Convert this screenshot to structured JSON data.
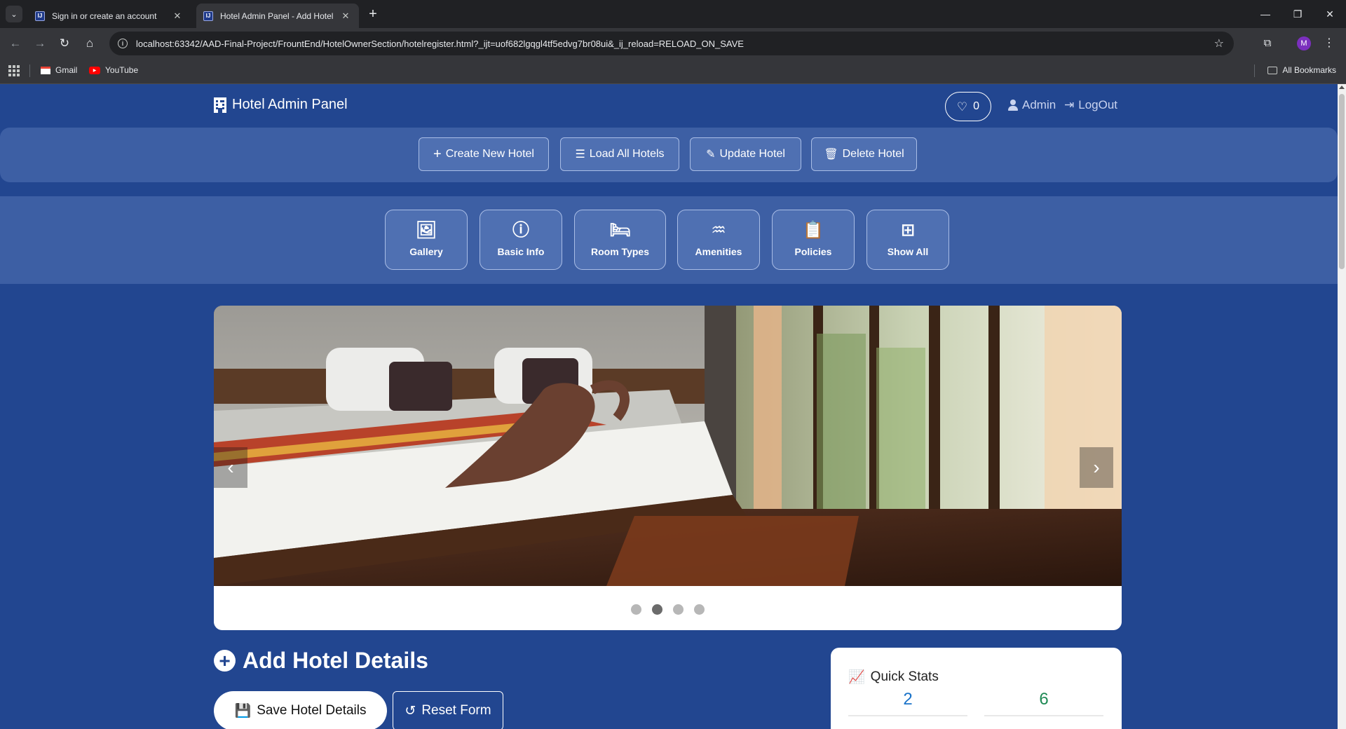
{
  "browser": {
    "tabs": [
      {
        "title": "Sign in or create an account",
        "favicon": "IJ"
      },
      {
        "title": "Hotel Admin Panel - Add Hotel",
        "favicon": "IJ"
      }
    ],
    "url": "localhost:63342/AAD-Final-Project/FrountEnd/HotelOwnerSection/hotelregister.html?_ijt=uof682lgqgl4tf5edvg7br08ui&_ij_reload=RELOAD_ON_SAVE",
    "profile_initial": "M",
    "bookmarks": [
      {
        "label": "Gmail"
      },
      {
        "label": "YouTube"
      }
    ],
    "all_bookmarks": "All Bookmarks"
  },
  "header": {
    "brand": "Hotel Admin Panel",
    "favorites_count": "0",
    "admin_label": "Admin",
    "logout_label": "LogOut"
  },
  "actions": [
    {
      "label": "Create New Hotel",
      "icon": "plus-icon"
    },
    {
      "label": "Load All Hotels",
      "icon": "list-icon"
    },
    {
      "label": "Update Hotel",
      "icon": "edit-icon"
    },
    {
      "label": "Delete Hotel",
      "icon": "trash-icon"
    }
  ],
  "sections": [
    {
      "label": "Gallery",
      "icon": "images-icon"
    },
    {
      "label": "Basic Info",
      "icon": "info-icon"
    },
    {
      "label": "Room Types",
      "icon": "bed-icon"
    },
    {
      "label": "Amenities",
      "icon": "pool-icon"
    },
    {
      "label": "Policies",
      "icon": "clipboard-icon"
    },
    {
      "label": "Show All",
      "icon": "grid-icon"
    }
  ],
  "carousel": {
    "slide_count": 4,
    "active_index": 1
  },
  "form": {
    "title": "Add Hotel Details",
    "save_label": "Save Hotel Details",
    "reset_label": "Reset Form"
  },
  "quick_stats": {
    "title": "Quick Stats",
    "values": [
      {
        "value": "2",
        "color": "#1a73c9"
      },
      {
        "value": "6",
        "color": "#1f8a55"
      }
    ]
  },
  "colors": {
    "page_bg": "#224690",
    "panel_bg": "#3d5fa4",
    "button_bg": "#4f70b2"
  }
}
